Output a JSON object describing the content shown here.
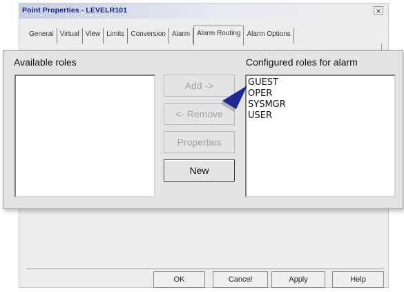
{
  "window": {
    "title": "Point Properties - LEVELR101",
    "close_label": "×"
  },
  "tabs": [
    {
      "label": "General"
    },
    {
      "label": "Virtual"
    },
    {
      "label": "View"
    },
    {
      "label": "Limits"
    },
    {
      "label": "Conversion"
    },
    {
      "label": "Alarm"
    },
    {
      "label": "Alarm Routing",
      "active": true
    },
    {
      "label": "Alarm Options"
    }
  ],
  "roles": {
    "available_label": "Available roles",
    "configured_label": "Configured roles for alarm",
    "available_items": [],
    "configured_items": [
      "GUEST",
      "OPER",
      "SYSMGR",
      "USER"
    ],
    "buttons": {
      "add": "Add ->",
      "remove": "<- Remove",
      "properties": "Properties",
      "new": "New"
    }
  },
  "footer": {
    "ok": "OK",
    "cancel": "Cancel",
    "apply": "Apply",
    "help": "Help"
  },
  "colors": {
    "title_text": "#0a1f8a",
    "pointer": "#1c2a8f",
    "disabled_text": "#a2a2a2"
  }
}
